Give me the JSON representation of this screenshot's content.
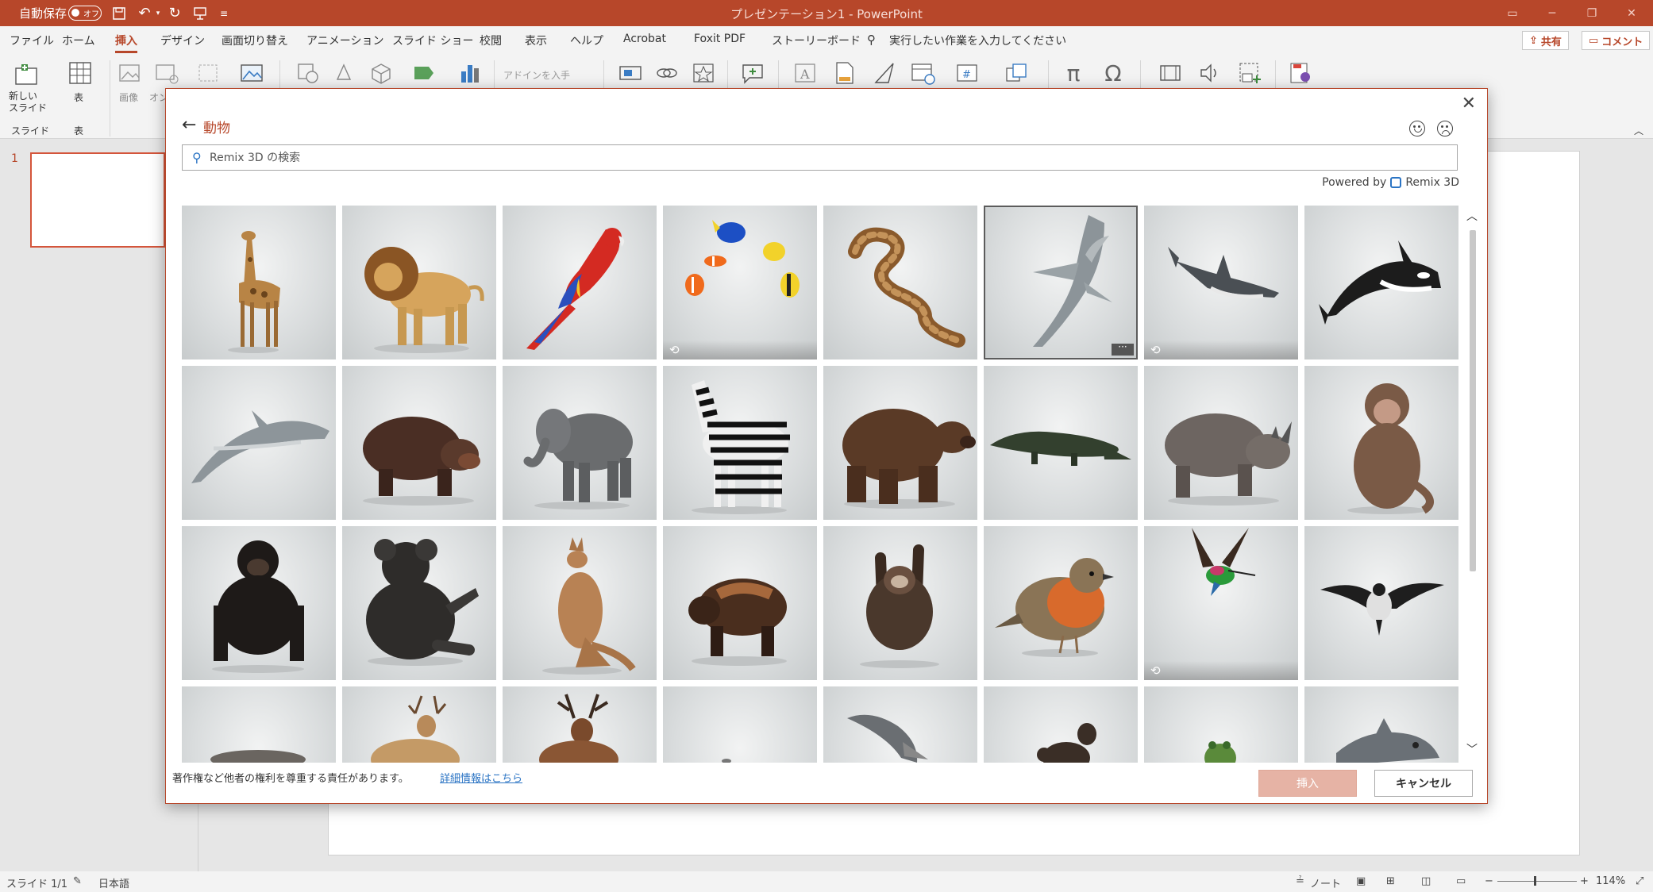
{
  "titlebar": {
    "autosave_label": "自動保存",
    "autosave_state": "オフ",
    "title": "プレゼンテーション1 - PowerPoint"
  },
  "tabs": [
    "ファイル",
    "ホーム",
    "挿入",
    "デザイン",
    "画面切り替え",
    "アニメーション",
    "スライド ショー",
    "校閲",
    "表示",
    "ヘルプ",
    "Acrobat",
    "Foxit PDF",
    "ストーリーボード"
  ],
  "active_tab": "挿入",
  "tell_me": "実行したい作業を入力してください",
  "share_label": "共有",
  "comment_label": "コメント",
  "ribbon": {
    "new_slide_label": "新しい\nスライド",
    "table_label": "表",
    "images_label": "画像",
    "online_label": "オン",
    "addin_label": "アドインを入手",
    "group_slide": "スライド",
    "group_table": "表"
  },
  "slide_number": "1",
  "dialog": {
    "category": "動物",
    "search_placeholder": "Remix 3D の検索",
    "powered_by": "Powered by",
    "remix_name": "Remix 3D",
    "footer_text": "著作権など他者の権利を尊重する責任があります。",
    "footer_link": "詳細情報はこちら",
    "insert_label": "挿入",
    "cancel_label": "キャンセル",
    "models": [
      {
        "name": "giraffe",
        "animated": false
      },
      {
        "name": "lion",
        "animated": false
      },
      {
        "name": "parrot",
        "animated": false
      },
      {
        "name": "tropical-fish",
        "animated": true
      },
      {
        "name": "snake",
        "animated": false
      },
      {
        "name": "shark",
        "animated": false,
        "selected": true
      },
      {
        "name": "shark-animated",
        "animated": true
      },
      {
        "name": "orca",
        "animated": false
      },
      {
        "name": "dolphin",
        "animated": false
      },
      {
        "name": "hippo",
        "animated": false
      },
      {
        "name": "elephant",
        "animated": false
      },
      {
        "name": "zebra",
        "animated": false
      },
      {
        "name": "bear",
        "animated": false
      },
      {
        "name": "crocodile",
        "animated": false
      },
      {
        "name": "rhino",
        "animated": false
      },
      {
        "name": "monkey",
        "animated": false
      },
      {
        "name": "chimpanzee",
        "animated": false
      },
      {
        "name": "koala",
        "animated": false
      },
      {
        "name": "kangaroo",
        "animated": false
      },
      {
        "name": "wolverine",
        "animated": false
      },
      {
        "name": "sloth",
        "animated": false
      },
      {
        "name": "robin",
        "animated": false
      },
      {
        "name": "hummingbird",
        "animated": true
      },
      {
        "name": "bird-flying",
        "animated": false
      },
      {
        "name": "seal",
        "animated": false
      },
      {
        "name": "deer",
        "animated": false
      },
      {
        "name": "stag",
        "animated": false
      },
      {
        "name": "blank",
        "animated": false
      },
      {
        "name": "fish",
        "animated": false
      },
      {
        "name": "otter",
        "animated": false
      },
      {
        "name": "frog",
        "animated": false
      },
      {
        "name": "fish-2",
        "animated": false
      }
    ]
  },
  "status": {
    "slide": "スライド 1/1",
    "language": "日本語",
    "notes": "ノート",
    "zoom": "114%"
  },
  "colors": {
    "accent": "#b7472a",
    "link": "#2b74c4"
  }
}
